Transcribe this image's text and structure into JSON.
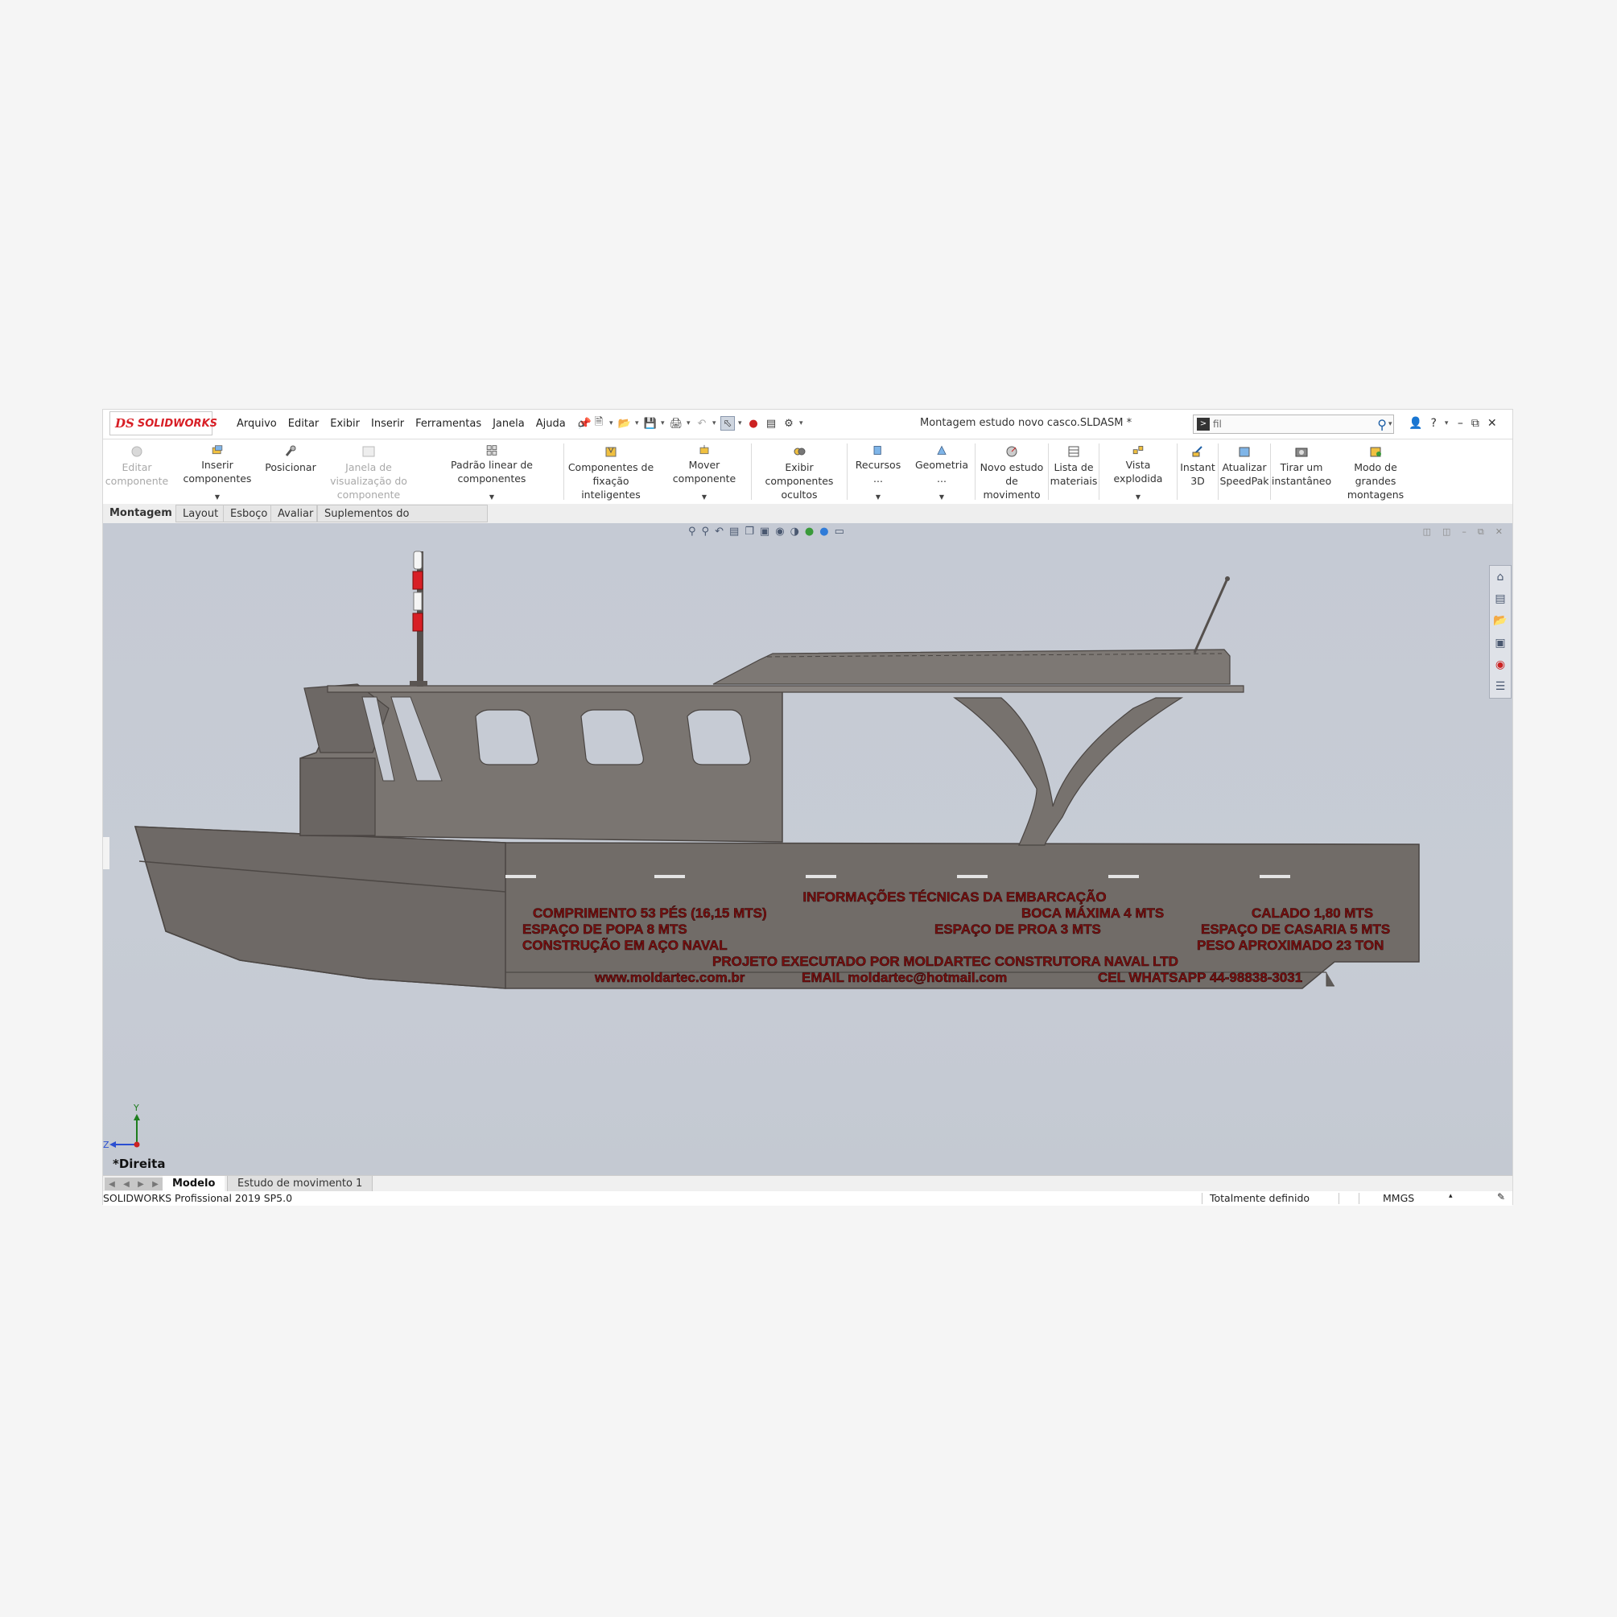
{
  "app": {
    "logo_text": "SOLIDWORKS",
    "logo_mark": "DS"
  },
  "menu": [
    "Arquivo",
    "Editar",
    "Exibir",
    "Inserir",
    "Ferramentas",
    "Janela",
    "Ajuda"
  ],
  "document_title": "Montagem estudo novo casco.SLDASM *",
  "search": {
    "value": "fil"
  },
  "ribbon": [
    {
      "label": "Editar componente",
      "icon": "edit-component-icon",
      "enabled": false
    },
    {
      "label": "Inserir componentes",
      "icon": "insert-components-icon",
      "enabled": true,
      "dropdown": true
    },
    {
      "label": "Posicionar",
      "icon": "mate-icon",
      "enabled": true
    },
    {
      "label": "Janela de visualização do componente",
      "icon": "component-preview-icon",
      "enabled": false
    },
    {
      "label": "Padrão linear de componentes",
      "icon": "linear-pattern-icon",
      "enabled": true,
      "dropdown": true
    },
    {
      "label": "Componentes de fixação inteligentes",
      "icon": "smart-fasteners-icon",
      "enabled": true
    },
    {
      "label": "Mover componente",
      "icon": "move-component-icon",
      "enabled": true,
      "dropdown": true
    },
    {
      "label": "Exibir componentes ocultos",
      "icon": "show-hidden-icon",
      "enabled": true
    },
    {
      "label": "Recursos ...",
      "icon": "assembly-features-icon",
      "enabled": true,
      "dropdown": true
    },
    {
      "label": "Geometria ...",
      "icon": "reference-geometry-icon",
      "enabled": true,
      "dropdown": true
    },
    {
      "label": "Novo estudo de movimento",
      "icon": "motion-study-icon",
      "enabled": true
    },
    {
      "label": "Lista de materiais",
      "icon": "bom-icon",
      "enabled": true
    },
    {
      "label": "Vista explodida",
      "icon": "exploded-view-icon",
      "enabled": true,
      "dropdown": true
    },
    {
      "label": "Instant 3D",
      "icon": "instant3d-icon",
      "enabled": true
    },
    {
      "label": "Atualizar SpeedPak",
      "icon": "speedpak-icon",
      "enabled": true
    },
    {
      "label": "Tirar um instantâneo",
      "icon": "snapshot-icon",
      "enabled": true
    },
    {
      "label": "Modo de grandes montagens",
      "icon": "large-assembly-icon",
      "enabled": true
    }
  ],
  "command_tabs": [
    "Montagem",
    "Layout",
    "Esboço",
    "Avaliar",
    "Suplementos do SOLIDWORKS"
  ],
  "active_command_tab": "Montagem",
  "viewport": {
    "view_name": "*Direita",
    "triad": {
      "y": "Y",
      "z": "Z"
    },
    "hull_text": {
      "heading": "INFORMAÇÕES TÉCNICAS DA EMBARCAÇÃO",
      "comprimento": "COMPRIMENTO 53 PÉS (16,15 MTS)",
      "boca": "BOCA MÁXIMA 4 MTS",
      "calado": "CALADO 1,80 MTS",
      "popa": "ESPAÇO DE POPA 8 MTS",
      "proa": "ESPAÇO DE PROA 3 MTS",
      "casaria": "ESPAÇO DE CASARIA 5 MTS",
      "construcao": "CONSTRUÇÃO EM AÇO NAVAL",
      "peso": "PESO APROXIMADO 23 TON",
      "projeto": "PROJETO   EXECUTADO POR MOLDARTEC CONSTRUTORA NAVAL LTD",
      "site": "www.moldartec.com.br",
      "email": "EMAIL moldartec@hotmail.com",
      "whatsapp": "CEL WHATSAPP  44-98838-3031"
    },
    "colors": {
      "background": "#c6cbd4",
      "hull": "#716c68",
      "text": "#7a0f0f",
      "mast_red": "#d81f26"
    }
  },
  "bottom_tabs": [
    "Modelo",
    "Estudo de movimento 1"
  ],
  "status": {
    "version": "SOLIDWORKS Profissional 2019 SP5.0",
    "state": "Totalmente definido",
    "units": "MMGS"
  }
}
